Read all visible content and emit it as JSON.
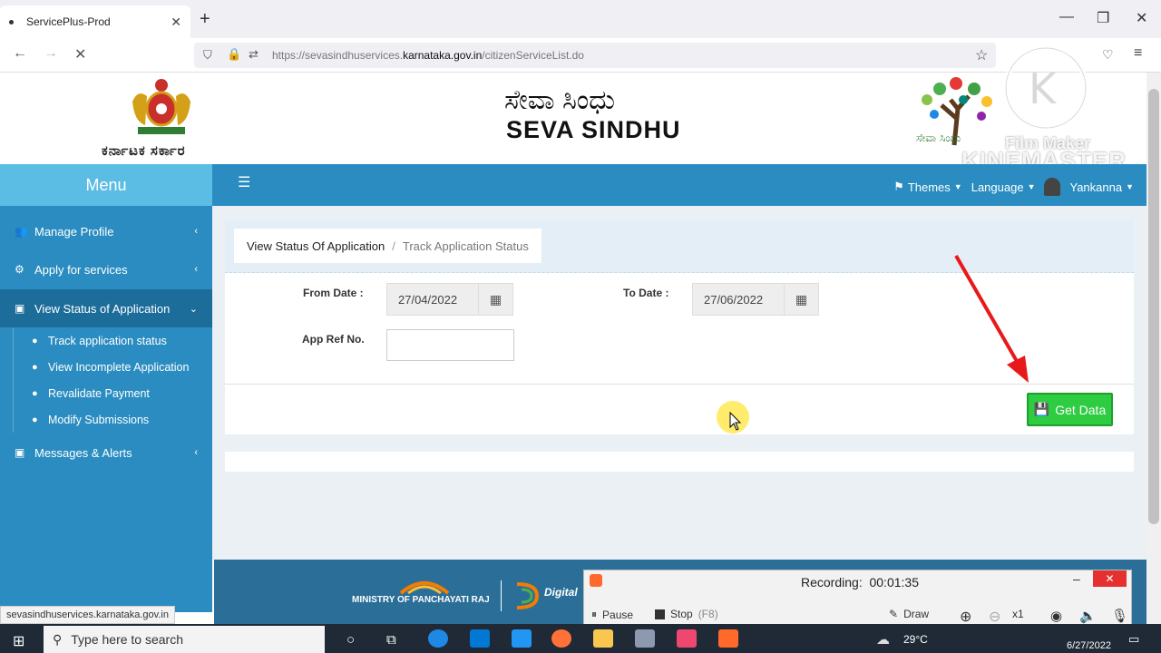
{
  "browser": {
    "tab_title": "ServicePlus-Prod",
    "url_prefix": "https://sevasindhuservices.",
    "url_domain": "karnataka.gov.in",
    "url_path": "/citizenServiceList.do"
  },
  "header": {
    "karnataka_text": "ಕರ್ನಾಟಕ ಸರ್ಕಾರ",
    "seva_kannada": "ಸೇವಾ ಸಿಂಧು",
    "seva_english": "SEVA SINDHU"
  },
  "menu": {
    "title": "Menu"
  },
  "topbar": {
    "themes": "Themes",
    "language": "Language",
    "user": "Yankanna"
  },
  "sidebar": {
    "items": [
      {
        "label": "Manage Profile"
      },
      {
        "label": "Apply for services"
      },
      {
        "label": "View Status of Application"
      },
      {
        "label": "Messages & Alerts"
      }
    ],
    "subitems": [
      {
        "label": "Track application status"
      },
      {
        "label": "View Incomplete Application"
      },
      {
        "label": "Revalidate Payment"
      },
      {
        "label": "Modify Submissions"
      }
    ]
  },
  "breadcrumb": {
    "current": "View Status Of Application",
    "separator": "/",
    "last": "Track Application Status"
  },
  "form": {
    "from_label": "From Date :",
    "from_value": "27/04/2022",
    "to_label": "To Date :",
    "to_value": "27/06/2022",
    "ref_label": "App Ref No.",
    "ref_value": "",
    "submit_label": "Get Data"
  },
  "footer": {
    "ministry": "MINISTRY OF PANCHAYATI RAJ",
    "digital": "Digital"
  },
  "status_url": "sevasindhuservices.karnataka.gov.in",
  "recorder": {
    "label": "Recording:",
    "time": "00:01:35",
    "pause": "Pause",
    "stop": "Stop",
    "stop_key": "(F8)",
    "draw": "Draw",
    "zoom": "x1"
  },
  "taskbar": {
    "search_placeholder": "Type here to search",
    "temperature": "29°C",
    "date": "6/27/2022"
  },
  "watermark": {
    "film_maker": "Film Maker",
    "kinemaster": "KINEMASTER"
  },
  "colors": {
    "sidebar": "#2a8cc0",
    "menu_header": "#5bbde4",
    "submit": "#2ecc40",
    "arrow": "#e8191b"
  }
}
